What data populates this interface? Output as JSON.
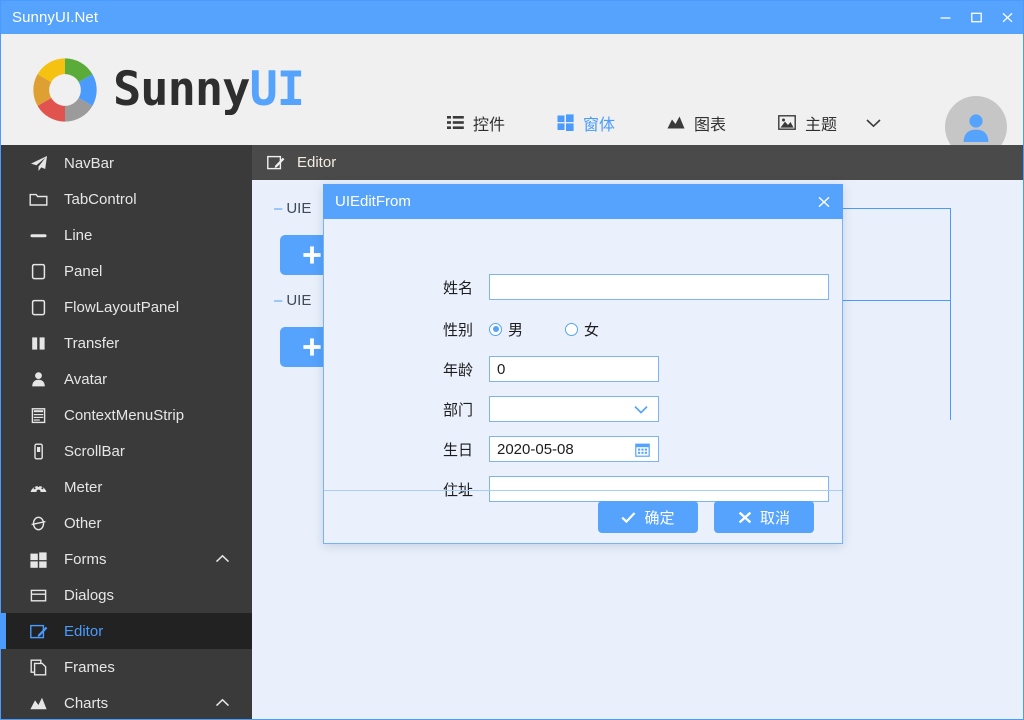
{
  "window": {
    "title": "SunnyUI.Net",
    "controls": [
      {
        "name": "minimize",
        "glyph": "minimize-icon"
      },
      {
        "name": "maximize",
        "glyph": "maximize-icon"
      },
      {
        "name": "close",
        "glyph": "close-icon"
      }
    ]
  },
  "brand": {
    "logo_icon": "sunnyui-donut-logo",
    "text_dark": "Sunny",
    "text_blue": "UI",
    "segment_colors": [
      "#f5c211",
      "#5aab3a",
      "#4a9bfc",
      "#9b9b9b",
      "#e0534f",
      "#dfa033"
    ]
  },
  "nav": {
    "tabs": [
      {
        "label": "控件",
        "icon": "list-icon",
        "active": false
      },
      {
        "label": "窗体",
        "icon": "windows-icon",
        "active": true
      },
      {
        "label": "图表",
        "icon": "chart-icon",
        "active": false
      },
      {
        "label": "主题",
        "icon": "image-icon",
        "active": false
      }
    ],
    "overflow_icon": "chevron-down-icon",
    "avatar_icon": "user-avatar-icon",
    "accent": "#4a9bfc"
  },
  "sidebar": {
    "items": [
      {
        "label": "NavBar",
        "icon": "paper-plane-icon",
        "level": 1,
        "active": false,
        "expandable": false
      },
      {
        "label": "TabControl",
        "icon": "folder-icon",
        "level": 1,
        "active": false,
        "expandable": false
      },
      {
        "label": "Line",
        "icon": "line-icon",
        "level": 1,
        "active": false,
        "expandable": false
      },
      {
        "label": "Panel",
        "icon": "panel-icon",
        "level": 1,
        "active": false,
        "expandable": false
      },
      {
        "label": "FlowLayoutPanel",
        "icon": "panel-icon",
        "level": 1,
        "active": false,
        "expandable": false
      },
      {
        "label": "Transfer",
        "icon": "transfer-icon",
        "level": 1,
        "active": false,
        "expandable": false
      },
      {
        "label": "Avatar",
        "icon": "avatar-icon",
        "level": 1,
        "active": false,
        "expandable": false
      },
      {
        "label": "ContextMenuStrip",
        "icon": "contextmenu-icon",
        "level": 1,
        "active": false,
        "expandable": false
      },
      {
        "label": "ScrollBar",
        "icon": "scrollbar-icon",
        "level": 1,
        "active": false,
        "expandable": false
      },
      {
        "label": "Meter",
        "icon": "meter-icon",
        "level": 1,
        "active": false,
        "expandable": false
      },
      {
        "label": "Other",
        "icon": "other-icon",
        "level": 1,
        "active": false,
        "expandable": false
      },
      {
        "label": "Forms",
        "icon": "windows-icon",
        "level": 0,
        "active": false,
        "expandable": true
      },
      {
        "label": "Dialogs",
        "icon": "dialog-icon",
        "level": 1,
        "active": false,
        "expandable": false
      },
      {
        "label": "Editor",
        "icon": "editor-icon",
        "level": 1,
        "active": true,
        "expandable": false
      },
      {
        "label": "Frames",
        "icon": "frames-icon",
        "level": 1,
        "active": false,
        "expandable": false
      },
      {
        "label": "Charts",
        "icon": "chart-icon",
        "level": 0,
        "active": false,
        "expandable": true
      }
    ],
    "scroll_up_icon": "chevron-up-icon",
    "scroll_down_icon": "chevron-down-icon"
  },
  "breadcrumb": {
    "icon": "editor-icon",
    "label": "Editor"
  },
  "background_page": {
    "sections": [
      {
        "label": "UIE",
        "dash": "–",
        "button_icon": "plus-icon"
      },
      {
        "label": "UIE",
        "dash": "–",
        "button_icon": "plus-icon"
      }
    ]
  },
  "dialog": {
    "title": "UIEditFrom",
    "close_icon": "close-icon",
    "fields": [
      {
        "label": "姓名",
        "type": "text",
        "value": "",
        "width": "wide",
        "name": "name-field"
      },
      {
        "label": "性别",
        "type": "radio",
        "name": "gender-field",
        "options": [
          {
            "label": "男",
            "checked": true
          },
          {
            "label": "女",
            "checked": false
          }
        ]
      },
      {
        "label": "年龄",
        "type": "text",
        "value": "0",
        "width": "mid",
        "name": "age-field"
      },
      {
        "label": "部门",
        "type": "combo",
        "value": "",
        "width": "mid",
        "name": "department-field",
        "icon": "chevron-down-icon"
      },
      {
        "label": "生日",
        "type": "date",
        "value": "2020-05-08",
        "width": "mid",
        "name": "birthday-field",
        "icon": "calendar-icon"
      },
      {
        "label": "住址",
        "type": "text",
        "value": "",
        "width": "wide",
        "name": "address-field"
      }
    ],
    "buttons": [
      {
        "label": "确定",
        "icon": "check-icon",
        "name": "ok-button"
      },
      {
        "label": "取消",
        "icon": "x-icon",
        "name": "cancel-button"
      }
    ],
    "accent": "#55a3fc"
  }
}
